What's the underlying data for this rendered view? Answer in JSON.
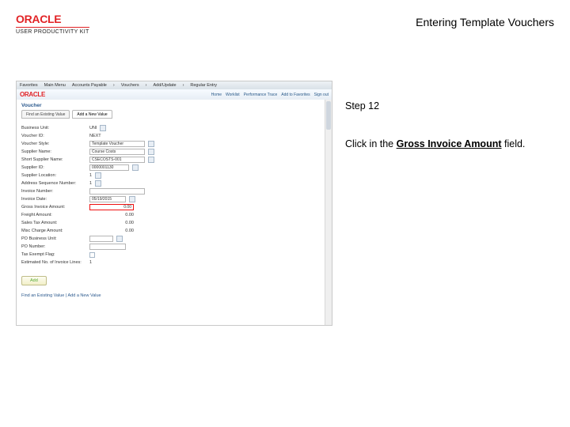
{
  "header": {
    "logo": "ORACLE",
    "logo_sub": "USER PRODUCTIVITY KIT",
    "doc_title": "Entering Template Vouchers"
  },
  "right": {
    "step_label": "Step 12",
    "instr_prefix": "Click in the ",
    "instr_bold": "Gross Invoice Amount",
    "instr_suffix": " field."
  },
  "shot": {
    "topnav": {
      "favorites": "Favorites",
      "main": "Main Menu",
      "crumb1": "Accounts Payable",
      "crumb2": "Vouchers",
      "crumb3": "Add/Update",
      "crumb4": "Regular Entry"
    },
    "brand": "ORACLE",
    "brandlinks": {
      "home": "Home",
      "worklist": "Worklist",
      "pcv": "Performance Trace",
      "add": "Add to Favorites",
      "signout": "Sign out"
    },
    "section": "Voucher",
    "tabs": {
      "t1": "Find an Existing Value",
      "t2": "Add a New Value"
    },
    "fields": {
      "bu": {
        "label": "Business Unit:",
        "value": "UNI"
      },
      "vid": {
        "label": "Voucher ID:",
        "value": "NEXT"
      },
      "style": {
        "label": "Voucher Style:",
        "value": "Template Voucher"
      },
      "sname": {
        "label": "Supplier Name:",
        "value": "Course Costs"
      },
      "sshort": {
        "label": "Short Supplier Name:",
        "value": "CSECOSTS-001"
      },
      "sid": {
        "label": "Supplier ID:",
        "value": "0000001130"
      },
      "sloc": {
        "label": "Supplier Location:",
        "value": "1"
      },
      "aseq": {
        "label": "Address Sequence Number:",
        "value": "1"
      },
      "invno": {
        "label": "Invoice Number:",
        "value": ""
      },
      "invdt": {
        "label": "Invoice Date:",
        "value": "05/19/2015"
      },
      "gross": {
        "label": "Gross Invoice Amount:",
        "value": "0.00"
      },
      "freight": {
        "label": "Freight Amount:",
        "value": "0.00"
      },
      "stax": {
        "label": "Sales Tax Amount:",
        "value": "0.00"
      },
      "misc": {
        "label": "Misc Charge Amount:",
        "value": "0.00"
      },
      "pobu": {
        "label": "PO Business Unit:",
        "value": ""
      },
      "ponum": {
        "label": "PO Number:",
        "value": ""
      },
      "tax": {
        "label": "Tax Exempt Flag:",
        "value": ""
      },
      "est": {
        "label": "Estimated No. of Invoice Lines:",
        "value": "1"
      }
    },
    "add": "Add",
    "footer": {
      "a": "Find an Existing Value",
      "sep": " | ",
      "b": "Add a New Value"
    }
  }
}
